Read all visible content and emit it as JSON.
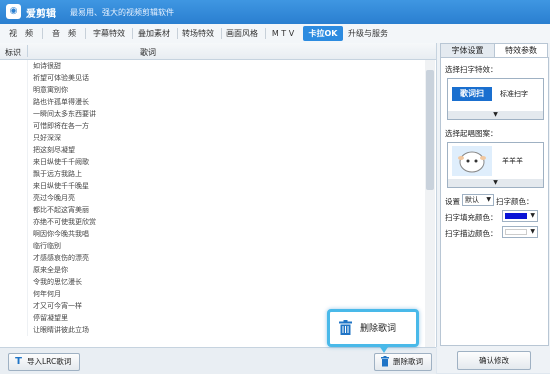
{
  "app": {
    "name": "爱剪辑",
    "slogan": "最易用、强大的视频剪辑软件",
    "logo_glyph": "◉"
  },
  "tabs": [
    {
      "label": "视　频"
    },
    {
      "label": "音　频"
    },
    {
      "label": "字幕特效"
    },
    {
      "label": "叠加素材"
    },
    {
      "label": "转场特效"
    },
    {
      "label": "画面风格"
    },
    {
      "label": "M T V"
    },
    {
      "label": "卡拉OK",
      "active": true
    },
    {
      "label": "升级与服务"
    }
  ],
  "list": {
    "col_mark": "标识",
    "col_lyric": "歌词",
    "rows": [
      "如诗很甜",
      "祈望可体验美见话",
      "明意寓别你",
      "路也许孤单得漫长",
      "一瞬间太多东西要讲",
      "可惜即将在各一方",
      "只好深深",
      "把这刻尽凝望",
      "来日纵使千千阙歌",
      "飘于远方我路上",
      "来日纵使千千晚星",
      "亮过今晚月亮",
      "都比不起这宵美丽",
      "亦绝不可使我更欣赏",
      "啊因你今晚共我唱",
      "临行临别",
      "才感感哀伤的漂亮",
      "原来全是你",
      "令我的思忆漫长",
      "何年何月",
      "才又可今宵一样",
      "停留凝望里",
      "让眼睛讲彼此立场"
    ]
  },
  "bottom": {
    "import_label": "导入LRC歌词",
    "delete_label": "删除歌词"
  },
  "tooltip": {
    "label": "删除歌词"
  },
  "right": {
    "tab_font": "字体设置",
    "tab_effect": "特效参数",
    "scan_effect_label": "选择扫字特效：",
    "scan_preview_badge": "歌词扫",
    "scan_preview_name": "标准扫字",
    "scan_arrow": "▼",
    "start_icon_label": "选择起唱图案：",
    "start_icon_name": "羊羊羊",
    "settings_label": "设置",
    "settings_value": "默认",
    "scan_color_label": "扫字颜色：",
    "fill_color_label": "扫字填充颜色：",
    "stroke_color_label": "扫字描边颜色：",
    "fill_color": "#0a14d6",
    "stroke_color": "#ffffff",
    "confirm_label": "确认修改"
  },
  "colors": {
    "accent": "#2c8be0",
    "tooltip_border": "#49b9e9"
  }
}
